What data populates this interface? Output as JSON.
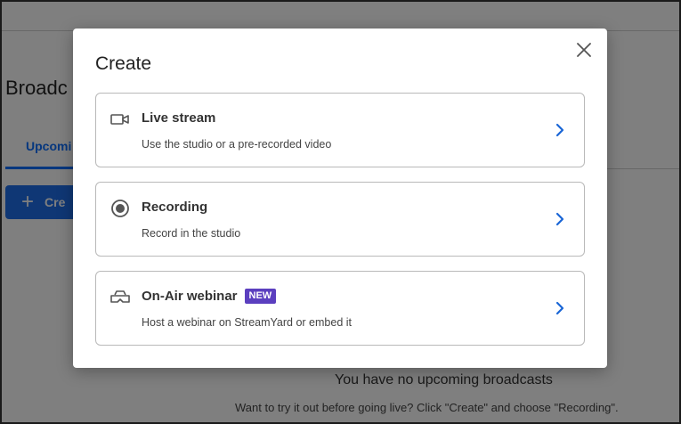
{
  "background": {
    "title": "Broadc",
    "tab_label": "Upcomi",
    "create_button": "Cre",
    "empty_title": "You have no upcoming broadcasts",
    "empty_hint": "Want to try it out before going live? Click \"Create\" and choose \"Recording\"."
  },
  "modal": {
    "title": "Create",
    "close_icon": "close-icon",
    "options": [
      {
        "icon": "video-camera-icon",
        "title": "Live stream",
        "description": "Use the studio or a pre-recorded video",
        "badge": ""
      },
      {
        "icon": "record-icon",
        "title": "Recording",
        "description": "Record in the studio",
        "badge": ""
      },
      {
        "icon": "vr-headset-icon",
        "title": "On-Air webinar",
        "description": "Host a webinar on StreamYard or embed it",
        "badge": "NEW"
      }
    ]
  },
  "colors": {
    "accent": "#1f6feb",
    "badge": "#5b3fbf",
    "chevron": "#1a66d6"
  }
}
